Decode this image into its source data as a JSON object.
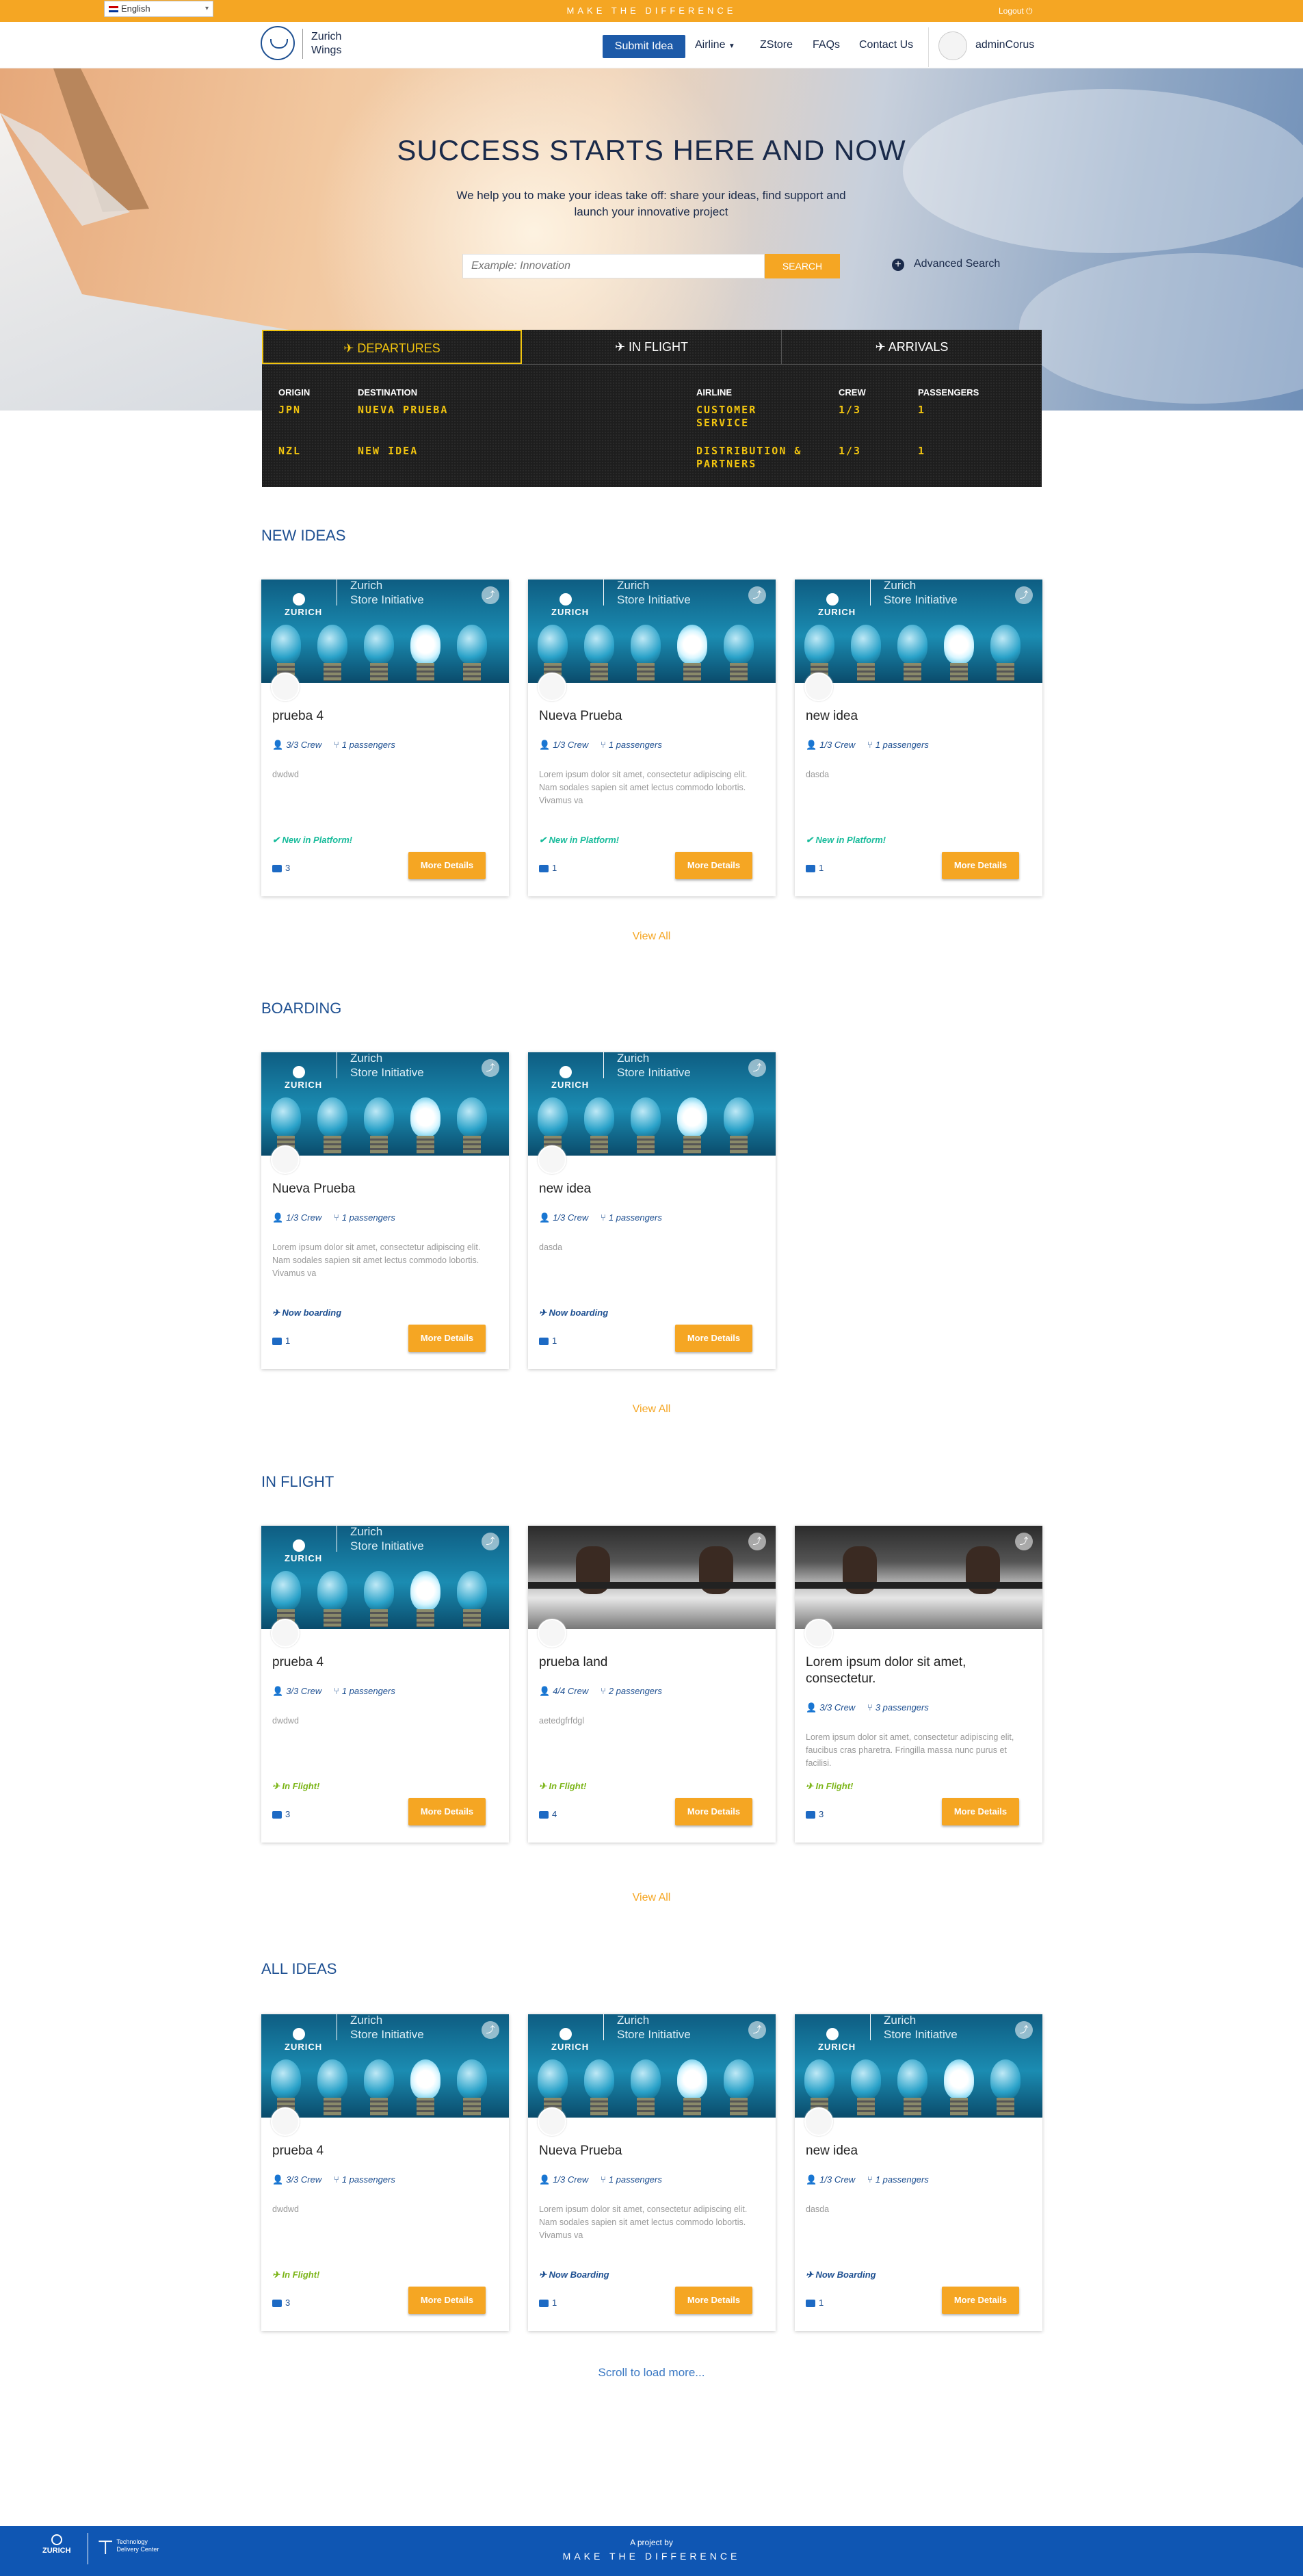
{
  "topbar": {
    "language": "English",
    "tagline": "MAKE THE DIFFERENCE",
    "logout": "Logout"
  },
  "navbar": {
    "brand_name": "Zurich Wings",
    "submit_idea": "Submit Idea",
    "links": [
      "Airline",
      "ZStore",
      "FAQs",
      "Contact Us"
    ],
    "user_name": "adminCorus"
  },
  "hero": {
    "title": "SUCCESS STARTS HERE AND NOW",
    "subtitle": "We help you to make your ideas take off: share your ideas, find support and launch your innovative project",
    "search_placeholder": "Example: Innovation",
    "search_button": "SEARCH",
    "advanced_search": "Advanced Search"
  },
  "board": {
    "tabs": [
      "DEPARTURES",
      "IN FLIGHT",
      "ARRIVALS"
    ],
    "columns": [
      "ORIGIN",
      "DESTINATION",
      "AIRLINE",
      "CREW",
      "PASSENGERS"
    ],
    "rows": [
      {
        "origin": "JPN",
        "destination": "NUEVA PRUEBA",
        "airline": "CUSTOMER SERVICE",
        "crew": "1/3",
        "passengers": "1"
      },
      {
        "origin": "NZL",
        "destination": "NEW IDEA",
        "airline": "DISTRIBUTION & PARTNERS",
        "crew": "1/3",
        "passengers": "1"
      }
    ]
  },
  "card_image": {
    "brand": "ZURICH",
    "initiative_line1": "Zurich",
    "initiative_line2": "Store Initiative"
  },
  "more_details": "More Details",
  "view_all": "View All",
  "sections": [
    {
      "title": "NEW IDEAS",
      "cards": [
        {
          "title": "prueba 4",
          "crew": "3/3 Crew",
          "passengers": "1 passengers",
          "desc": "dwdwd",
          "status": "New in Platform!",
          "comments": "3"
        },
        {
          "title": "Nueva Prueba",
          "crew": "1/3 Crew",
          "passengers": "1 passengers",
          "desc": "Lorem ipsum dolor sit amet, consectetur adipiscing elit. Nam sodales sapien sit amet lectus commodo lobortis. Vivamus va",
          "status": "New in Platform!",
          "comments": "1"
        },
        {
          "title": "new idea",
          "crew": "1/3 Crew",
          "passengers": "1 passengers",
          "desc": "dasda",
          "status": "New in Platform!",
          "comments": "1"
        }
      ]
    },
    {
      "title": "BOARDING",
      "cards": [
        {
          "title": "Nueva Prueba",
          "crew": "1/3 Crew",
          "passengers": "1 passengers",
          "desc": "Lorem ipsum dolor sit amet, consectetur adipiscing elit. Nam sodales sapien sit amet lectus commodo lobortis. Vivamus va",
          "status": "Now boarding",
          "comments": "1"
        },
        {
          "title": "new idea",
          "crew": "1/3 Crew",
          "passengers": "1 passengers",
          "desc": "dasda",
          "status": "Now boarding",
          "comments": "1"
        }
      ]
    },
    {
      "title": "IN FLIGHT",
      "cards": [
        {
          "title": "prueba 4",
          "crew": "3/3 Crew",
          "passengers": "1 passengers",
          "desc": "dwdwd",
          "status": "In Flight!",
          "comments": "3"
        },
        {
          "title": "prueba land",
          "crew": "4/4 Crew",
          "passengers": "2 passengers",
          "desc": "aetedgfrfdgl",
          "status": "In Flight!",
          "comments": "4"
        },
        {
          "title": "Lorem ipsum dolor sit amet, consectetur.",
          "crew": "3/3 Crew",
          "passengers": "3 passengers",
          "desc": "Lorem ipsum dolor sit amet, consectetur adipiscing elit, faucibus cras pharetra. Fringilla massa nunc purus et facilisi.",
          "status": "In Flight!",
          "comments": "3"
        }
      ]
    },
    {
      "title": "ALL IDEAS",
      "cards": [
        {
          "title": "prueba 4",
          "crew": "3/3 Crew",
          "passengers": "1 passengers",
          "desc": "dwdwd",
          "status": "In Flight!",
          "comments": "3"
        },
        {
          "title": "Nueva Prueba",
          "crew": "1/3 Crew",
          "passengers": "1 passengers",
          "desc": "Lorem ipsum dolor sit amet, consectetur adipiscing elit. Nam sodales sapien sit amet lectus commodo lobortis. Vivamus va",
          "status": "Now Boarding",
          "comments": "1"
        },
        {
          "title": "new idea",
          "crew": "1/3 Crew",
          "passengers": "1 passengers",
          "desc": "dasda",
          "status": "Now Boarding",
          "comments": "1"
        }
      ]
    }
  ],
  "scroll_more": "Scroll to load more...",
  "footer": {
    "brand": "ZURICH",
    "tdc_line1": "Technology",
    "tdc_line2": "Delivery Center",
    "project": "A project by",
    "tagline": "MAKE THE DIFFERENCE"
  },
  "colors": {
    "accent": "#f5a623",
    "brand_blue": "#1d4f91",
    "status_new": "#1abc9c",
    "status_boarding": "#1d4f91",
    "status_flight": "#7cb518"
  }
}
